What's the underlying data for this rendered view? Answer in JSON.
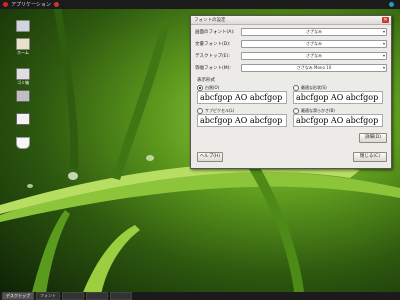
{
  "top_panel": {
    "app_title": "アプリケーション"
  },
  "desktop_icons": [
    "ホーム",
    "ゴミ箱",
    "",
    "",
    ""
  ],
  "dialog": {
    "title": "フォントの設定",
    "close_glyph": "✕",
    "rows": [
      {
        "label": "画面のフォント(A):",
        "value": "さざなみ"
      },
      {
        "label": "文書フォント(D):",
        "value": "さざなみ"
      },
      {
        "label": "デスクトップ(E):",
        "value": "さざなみ"
      },
      {
        "label": "等幅フォント(M):",
        "value": "さざなみ Mono 10"
      }
    ],
    "preview_label": "表示形式",
    "previews": [
      {
        "option": "白黒(O)",
        "sample": "abcfgop AO abcfgop",
        "selected": true
      },
      {
        "option": "最適な形状(S)",
        "sample": "abcfgop AO abcfgop",
        "selected": false
      },
      {
        "option": "サブピクセル(L)",
        "sample": "abcfgop AO abcfgop",
        "selected": false
      },
      {
        "option": "最適な滑らかさ(B)",
        "sample": "abcfgop AO abcfgop",
        "selected": false
      }
    ],
    "details_button": "詳細(D)",
    "help_button": "ヘルプ(H)",
    "close_button": "閉じる(C)"
  },
  "taskbar": {
    "tasks": [
      "デスクトップ",
      "フォント",
      "",
      "",
      ""
    ]
  },
  "colors": {
    "titlebar": "#dcdad5",
    "close": "#cc3b2b",
    "dialog_bg": "#ecebe8"
  }
}
